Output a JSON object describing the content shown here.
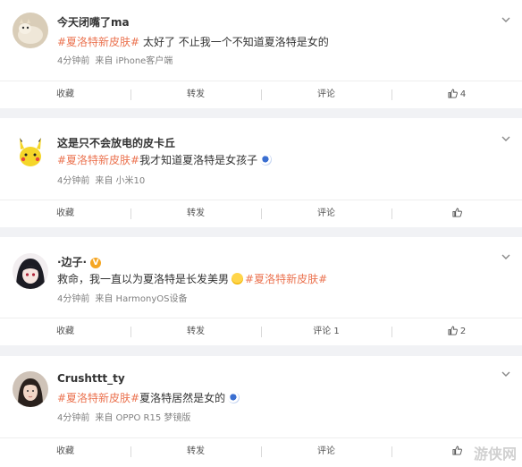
{
  "posts": [
    {
      "username": "今天闭嘴了ma",
      "verified": false,
      "tag": "#夏洛特新皮肤#",
      "text_before": "",
      "text_after": " 太好了 不止我一个不知道夏洛特是女的",
      "time": "4分钟前",
      "source": "来自 iPhone客户端",
      "actions": {
        "collect": "收藏",
        "repost": "转发",
        "comment": "评论",
        "like": "4"
      }
    },
    {
      "username": "这是只不会放电的皮卡丘",
      "verified": false,
      "tag": "#夏洛特新皮肤#",
      "text_before": "",
      "text_after": "我才知道夏洛特是女孩子",
      "time": "4分钟前",
      "source": "来自 小米10",
      "actions": {
        "collect": "收藏",
        "repost": "转发",
        "comment": "评论",
        "like": ""
      }
    },
    {
      "username": "·边子·",
      "verified": true,
      "tag": "#夏洛特新皮肤#",
      "text_before": "救命，我一直以为夏洛特是长发美男",
      "text_after": "",
      "time": "4分钟前",
      "source": "来自 HarmonyOS设备",
      "actions": {
        "collect": "收藏",
        "repost": "转发",
        "comment": "评论 1",
        "like": "2"
      }
    },
    {
      "username": "Crushttt_ty",
      "verified": false,
      "tag": "#夏洛特新皮肤#",
      "text_before": "",
      "text_after": "夏洛特居然是女的",
      "time": "4分钟前",
      "source": "来自 OPPO R15 梦镜版",
      "actions": {
        "collect": "收藏",
        "repost": "转发",
        "comment": "评论",
        "like": ""
      }
    }
  ],
  "watermark": "游侠网",
  "colors": {
    "tag": "#eb7350",
    "background": "#f1f2f5",
    "card": "#ffffff"
  }
}
